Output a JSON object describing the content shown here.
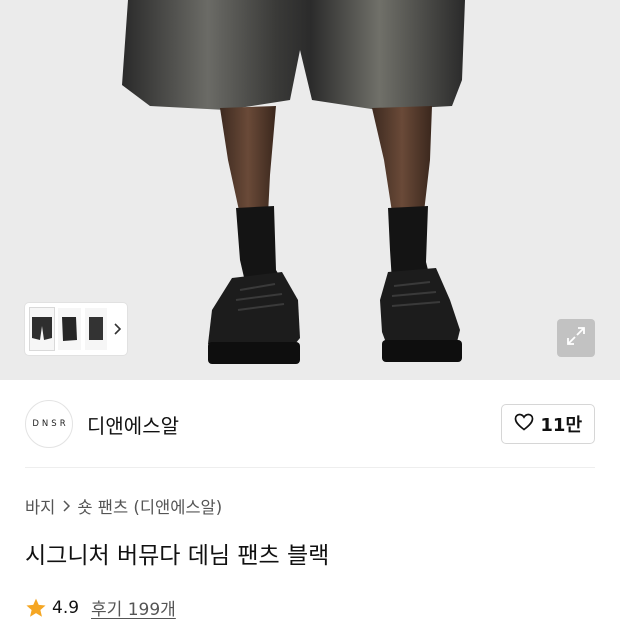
{
  "brand": {
    "logo_text": "DNSR",
    "name": "디앤에스알"
  },
  "like": {
    "count": "11만"
  },
  "breadcrumb": {
    "category": "바지",
    "subcategory": "숏 팬츠 (디앤에스알)"
  },
  "product": {
    "title": "시그니처 버뮤다 데님 팬츠 블랙"
  },
  "rating": {
    "score": "4.9",
    "reviews": "후기 199개"
  },
  "icons": {
    "like": "heart-outline-icon",
    "zoom": "expand-icon",
    "thumb_next": "chevron-right-icon",
    "breadcrumb_sep": "chevron-right-icon",
    "rating": "star-icon"
  },
  "colors": {
    "star": "#f5a623",
    "text_primary": "#111111",
    "text_secondary": "#555555",
    "photo_background": "#ebebeb"
  }
}
